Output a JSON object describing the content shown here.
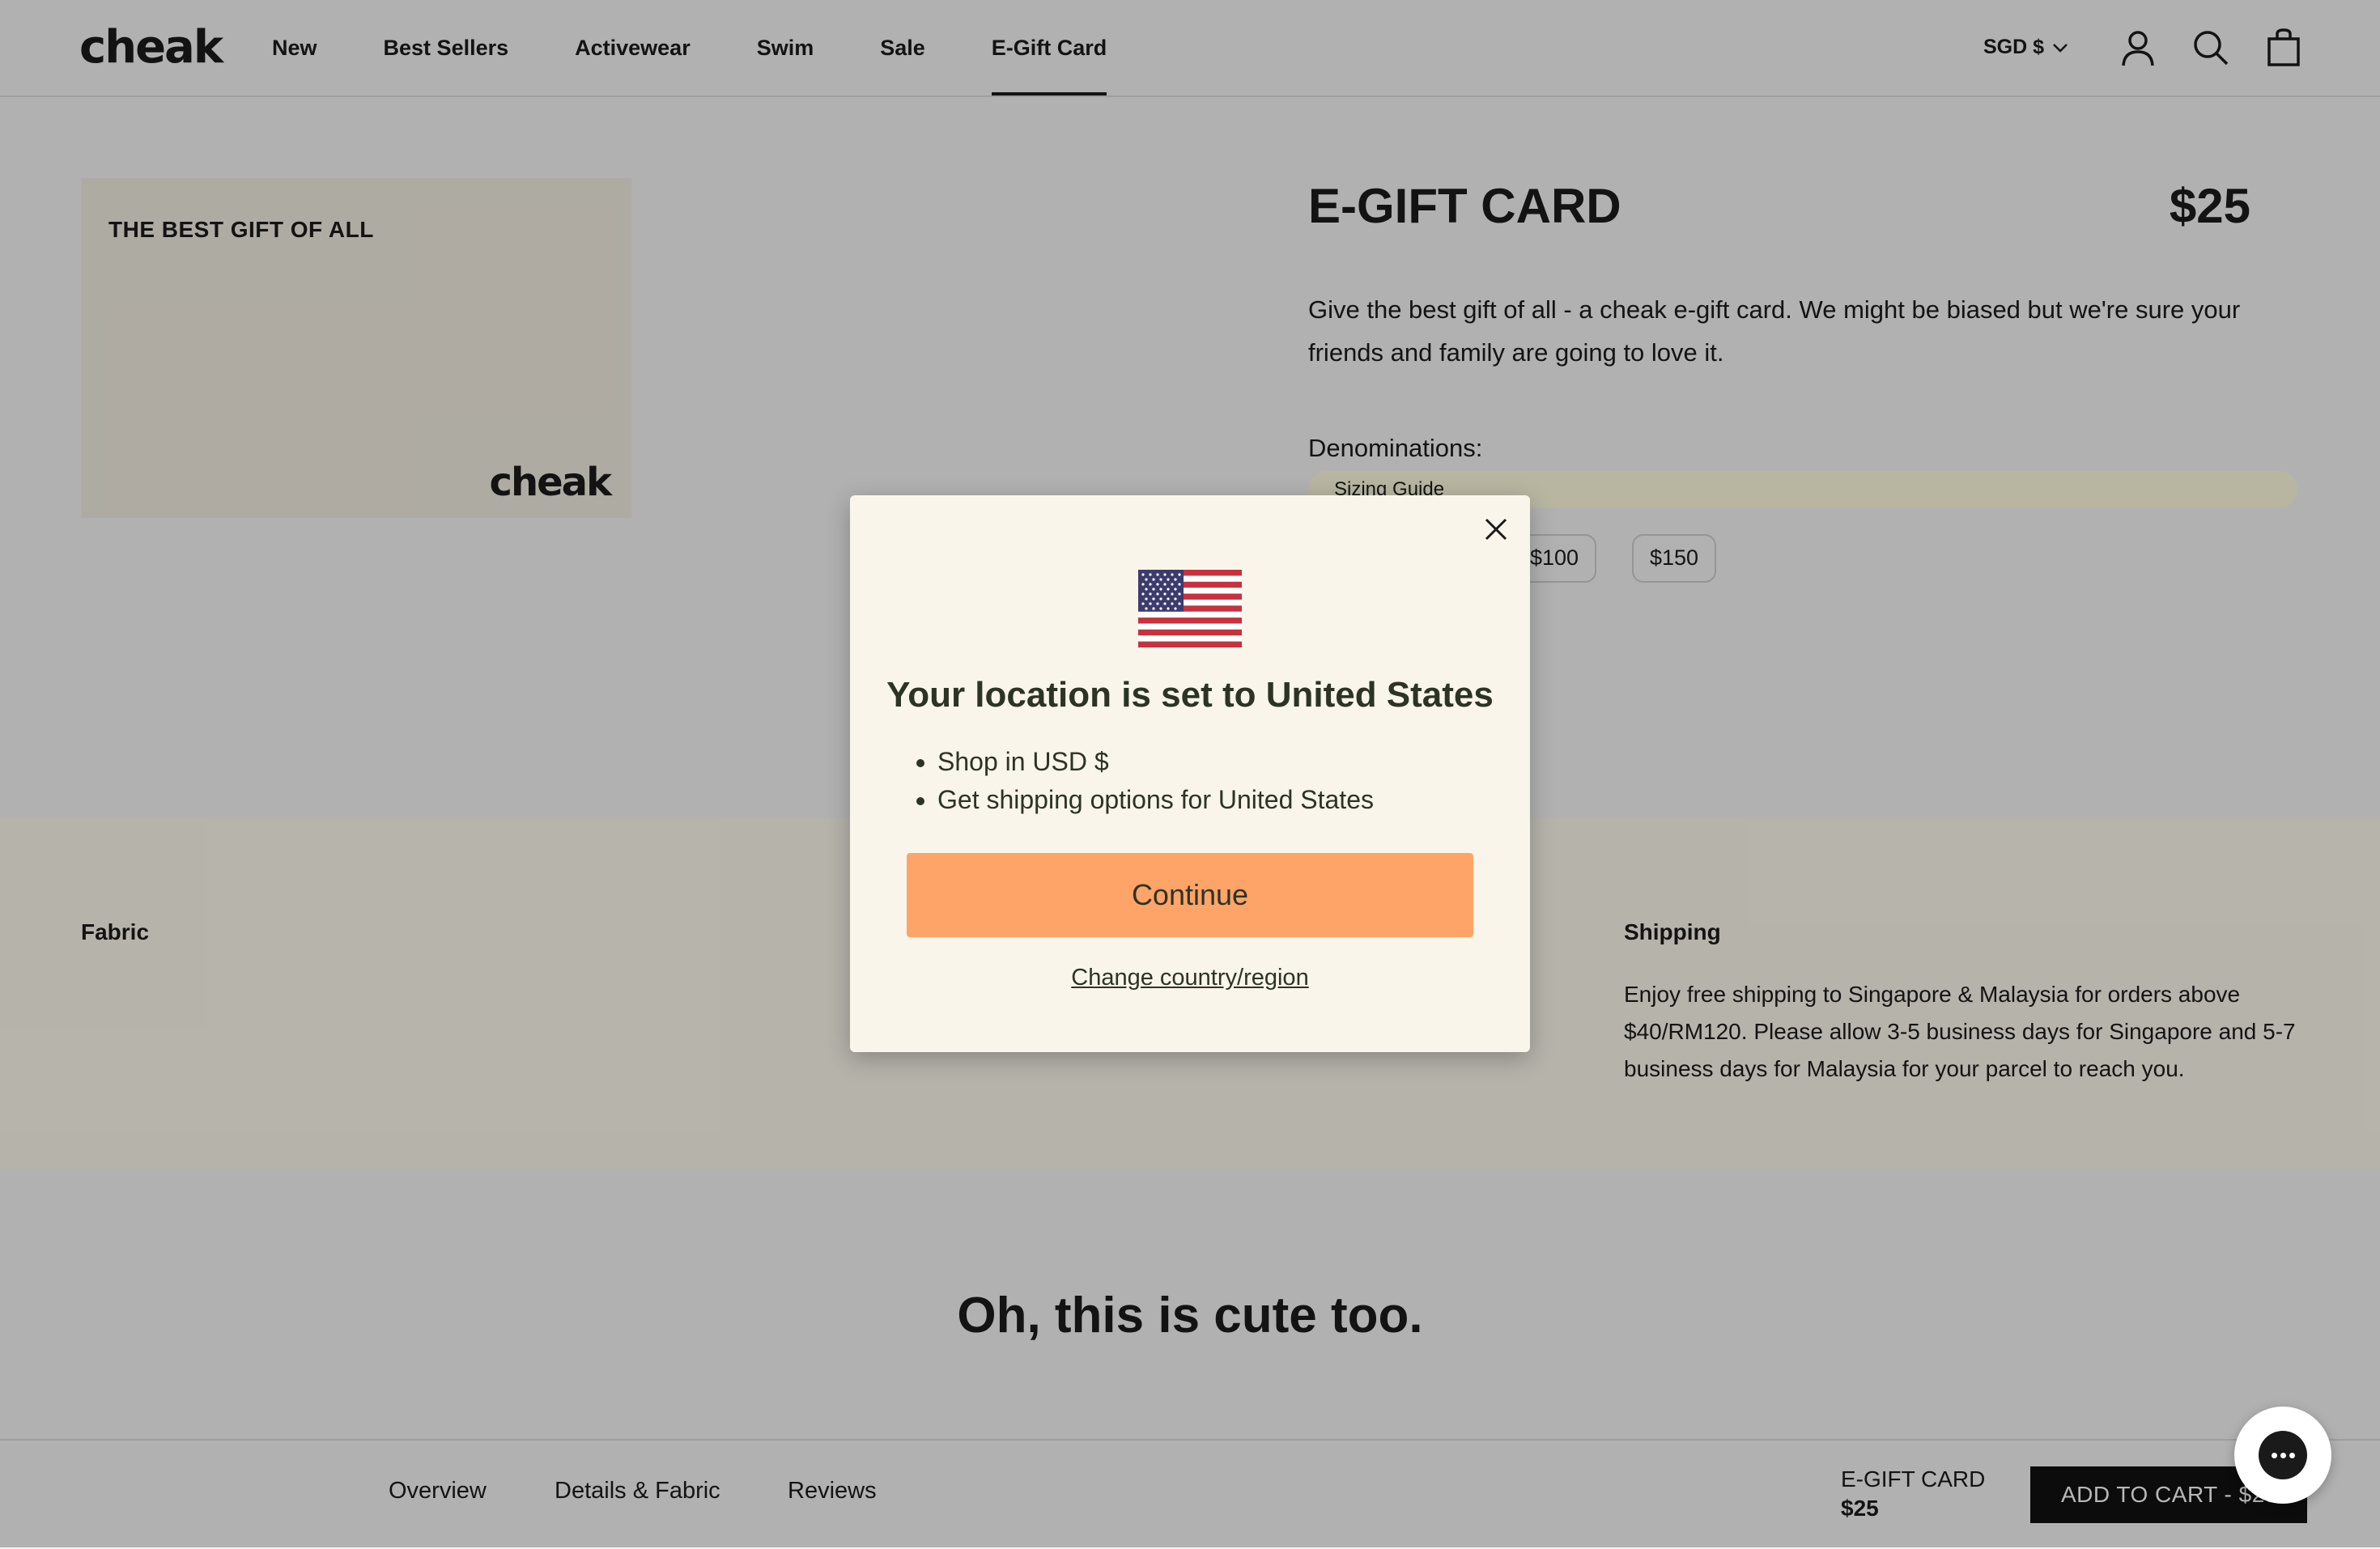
{
  "header": {
    "logo": "cheak",
    "nav": [
      "New",
      "Best Sellers",
      "Activewear",
      "Swim",
      "Sale",
      "E-Gift Card"
    ],
    "active_nav": "E-Gift Card",
    "currency": "SGD $",
    "icons": [
      "account-icon",
      "search-icon",
      "cart-icon"
    ]
  },
  "gift_card": {
    "tagline": "THE BEST GIFT OF ALL",
    "brand": "cheak"
  },
  "product": {
    "title": "E-GIFT CARD",
    "price": "$25",
    "description": "Give the best gift of all - a cheak e-gift card. We might be biased but we're sure your friends and family are going to love it.",
    "denominations_label": "Denominations:",
    "sizing_guide": "Sizing Guide",
    "denominations": [
      "$100",
      "$150"
    ]
  },
  "info_band": {
    "fabric_heading": "Fabric",
    "shipping_heading": "Shipping",
    "shipping_text": "Enjoy free shipping to Singapore & Malaysia for orders above $40/RM120. Please allow 3-5 business days for Singapore and 5-7 business days for Malaysia for your parcel to reach you."
  },
  "recommend_heading": "Oh, this is cute too.",
  "bottom_bar": {
    "tabs": [
      "Overview",
      "Details & Fabric",
      "Reviews"
    ],
    "product_title": "E-GIFT CARD",
    "product_price": "$25",
    "add_to_cart": "ADD TO CART  -  $25"
  },
  "modal": {
    "title": "Your location is set to United States",
    "bullets": [
      "Shop in USD $",
      "Get shipping options for United States"
    ],
    "continue": "Continue",
    "change": "Change country/region",
    "flag": "us-flag-icon"
  },
  "colors": {
    "continue_button": "#ffa468",
    "modal_bg": "#faf5ea",
    "band_bg": "#fdf9ed",
    "sizing_bg": "#fffde0"
  }
}
